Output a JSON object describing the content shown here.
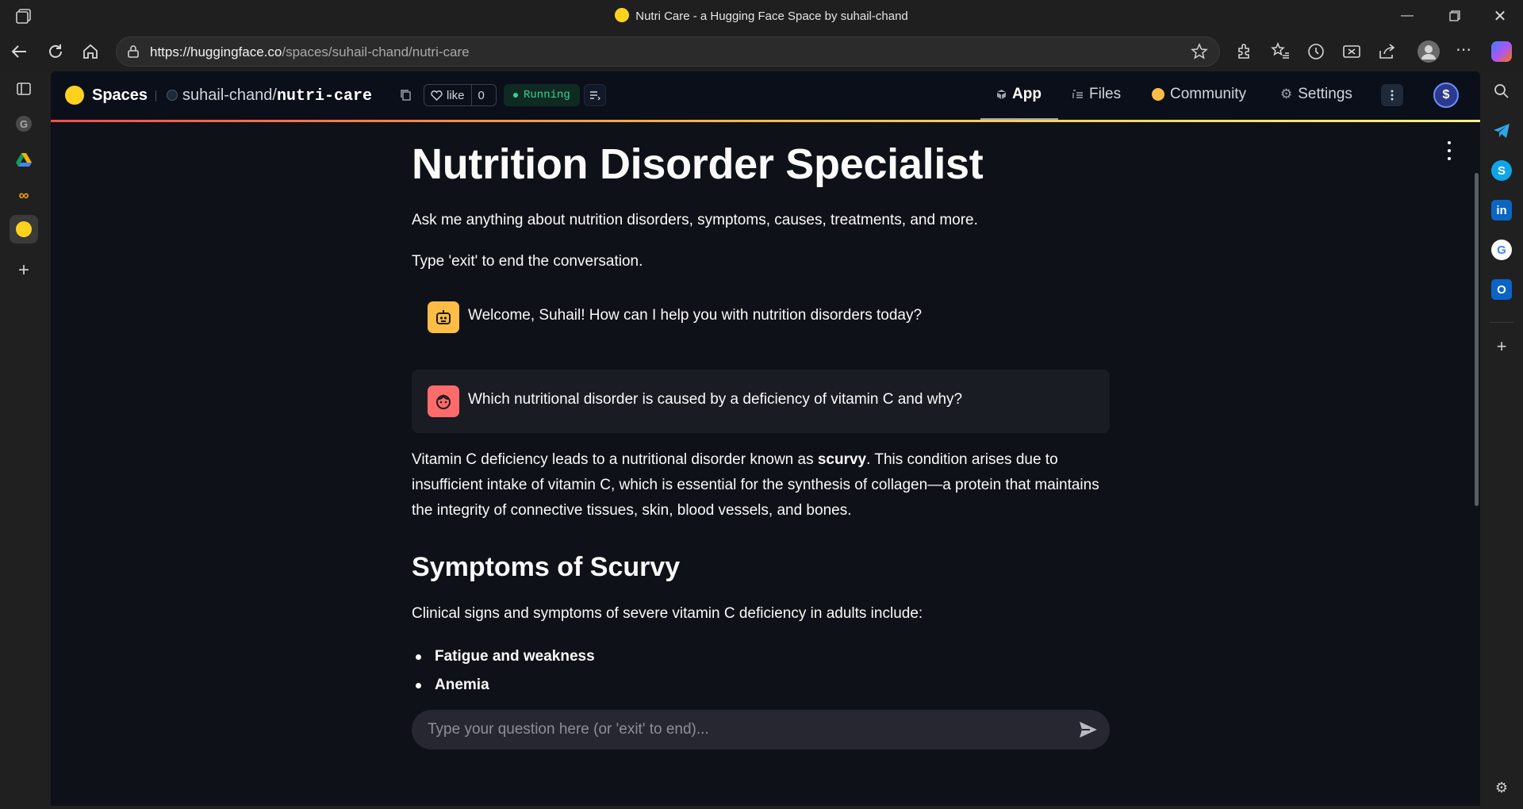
{
  "window": {
    "title": "Nutri Care - a Hugging Face Space by suhail-chand"
  },
  "browser": {
    "url_host": "https://huggingface.co",
    "url_path": "/spaces/suhail-chand/nutri-care"
  },
  "hf_header": {
    "spaces_label": "Spaces",
    "owner": "suhail-chand",
    "slash": "/",
    "repo": "nutri-care",
    "like_label": "like",
    "like_count": "0",
    "status": "Running",
    "tabs": [
      {
        "label": "App"
      },
      {
        "label": "Files"
      },
      {
        "label": "Community"
      },
      {
        "label": "Settings"
      }
    ],
    "avatar_letter": "$"
  },
  "page": {
    "title": "Nutrition Disorder Specialist",
    "intro": "Ask me anything about nutrition disorders, symptoms, causes, treatments, and more.",
    "exit_note": "Type 'exit' to end the conversation.",
    "messages": [
      {
        "role": "assistant",
        "text": "Welcome, Suhail! How can I help you with nutrition disorders today?"
      },
      {
        "role": "user",
        "text": "Which nutritional disorder is caused by a deficiency of vitamin C and why?"
      }
    ],
    "answer": {
      "before_bold": "Vitamin C deficiency leads to a nutritional disorder known as ",
      "bold": "scurvy",
      "after_bold_line1": ". This condition arises due to",
      "line2": "insufficient intake of vitamin C, which is essential for the synthesis of collagen—a protein that maintains",
      "line3": "the integrity of connective tissues, skin, blood vessels, and bones."
    },
    "section_heading": "Symptoms of Scurvy",
    "section_intro": "Clinical signs and symptoms of severe vitamin C deficiency in adults include:",
    "symptoms": [
      "Fatigue and weakness",
      "Anemia"
    ]
  },
  "chat_input": {
    "placeholder": "Type your question here (or 'exit' to end)..."
  },
  "colors": {
    "app_bg": "#0e1117",
    "assistant_avatar": "#ffbd45",
    "user_avatar": "#ff6b6b",
    "user_bubble": "#1a1c24",
    "running": "#34d399"
  }
}
